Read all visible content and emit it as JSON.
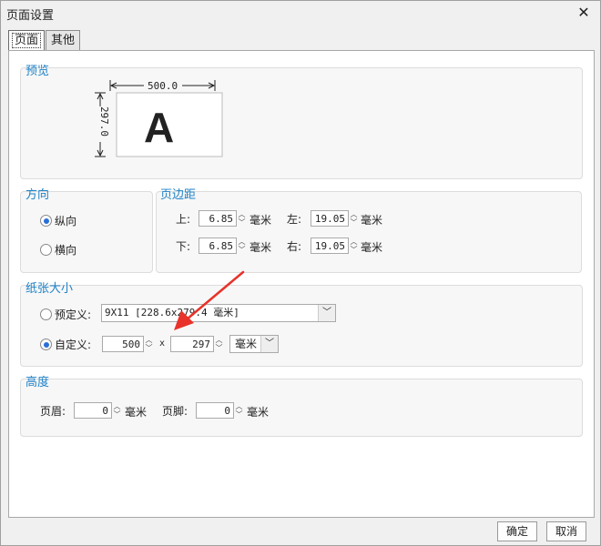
{
  "window": {
    "title": "页面设置",
    "close_glyph": "✕"
  },
  "tabs": [
    {
      "label": "页面"
    },
    {
      "label": "其他"
    }
  ],
  "preview": {
    "group_label": "预览",
    "width_label": "500.0",
    "height_label": "297.0",
    "letter": "A"
  },
  "orientation": {
    "group_label": "方向",
    "portrait_label": "纵向",
    "landscape_label": "横向",
    "selected": "portrait"
  },
  "margins": {
    "group_label": "页边距",
    "top_label": "上:",
    "top_value": "6.85",
    "left_label": "左:",
    "left_value": "19.05",
    "bottom_label": "下:",
    "bottom_value": "6.85",
    "right_label": "右:",
    "right_value": "19.05",
    "unit": "毫米"
  },
  "paper": {
    "group_label": "纸张大小",
    "predefined_label": "预定义:",
    "predefined_value": "9X11 [228.6x279.4 毫米]",
    "custom_label": "自定义:",
    "width_value": "500",
    "times": "x",
    "height_value": "297",
    "unit_value": "毫米",
    "selected": "custom"
  },
  "height": {
    "group_label": "高度",
    "header_label": "页眉:",
    "header_value": "0",
    "footer_label": "页脚:",
    "footer_value": "0",
    "unit": "毫米"
  },
  "buttons": {
    "ok_label": "确定",
    "cancel_label": "取消"
  },
  "colors": {
    "group_label": "#1e82c8",
    "annotation_arrow": "#e8322a",
    "radio_selected": "#2a6fd6"
  }
}
